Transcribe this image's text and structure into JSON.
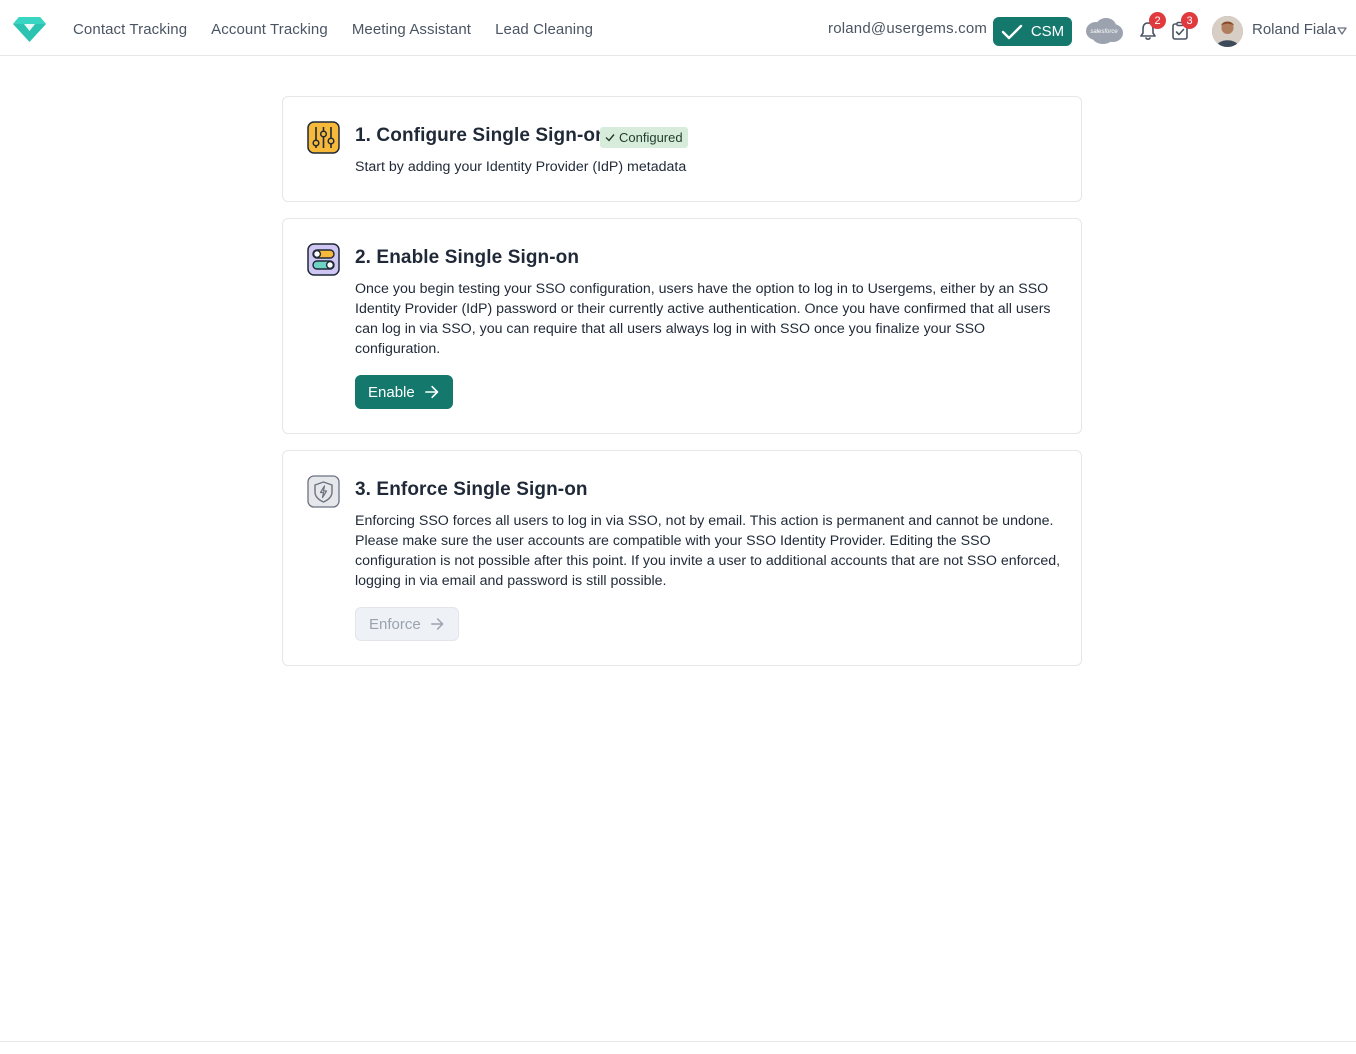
{
  "nav": {
    "items": [
      "Contact Tracking",
      "Account Tracking",
      "Meeting Assistant",
      "Lead Cleaning"
    ]
  },
  "header": {
    "email": "roland@usergems.com",
    "csm_label": "CSM",
    "salesforce_label": "salesforce",
    "notifications_count": "2",
    "tasks_count": "3",
    "user_name": "Roland Fiala"
  },
  "steps": [
    {
      "title": "1. Configure Single Sign-on",
      "status": "Configured",
      "description": "Start by adding your Identity Provider (IdP) metadata"
    },
    {
      "title": "2. Enable Single Sign-on",
      "description": "Once you begin testing your SSO configuration, users have the option to log in to Usergems, either by an SSO Identity Provider (IdP) password or their currently active authentication. Once you have confirmed that all users can log in via SSO, you can require that all users always log in with SSO once you finalize your SSO configuration.",
      "button": "Enable"
    },
    {
      "title": "3. Enforce Single Sign-on",
      "description": "Enforcing SSO forces all users to log in via SSO, not by email. This action is permanent and cannot be undone. Please make sure the user accounts are compatible with your SSO Identity Provider. Editing the SSO configuration is not possible after this point. If you invite a user to additional accounts that are not SSO enforced, logging in via email and password is still possible.",
      "button": "Enforce"
    }
  ],
  "colors": {
    "accent": "#15786d",
    "badge": "#e0393e",
    "configured_bg": "#d8ecdc"
  },
  "icons": [
    "gem-logo-icon",
    "check-icon",
    "salesforce-cloud-icon",
    "bell-icon",
    "clipboard-check-icon",
    "caret-down-icon",
    "sliders-icon",
    "toggles-icon",
    "shield-bolt-icon",
    "arrow-right-icon"
  ]
}
